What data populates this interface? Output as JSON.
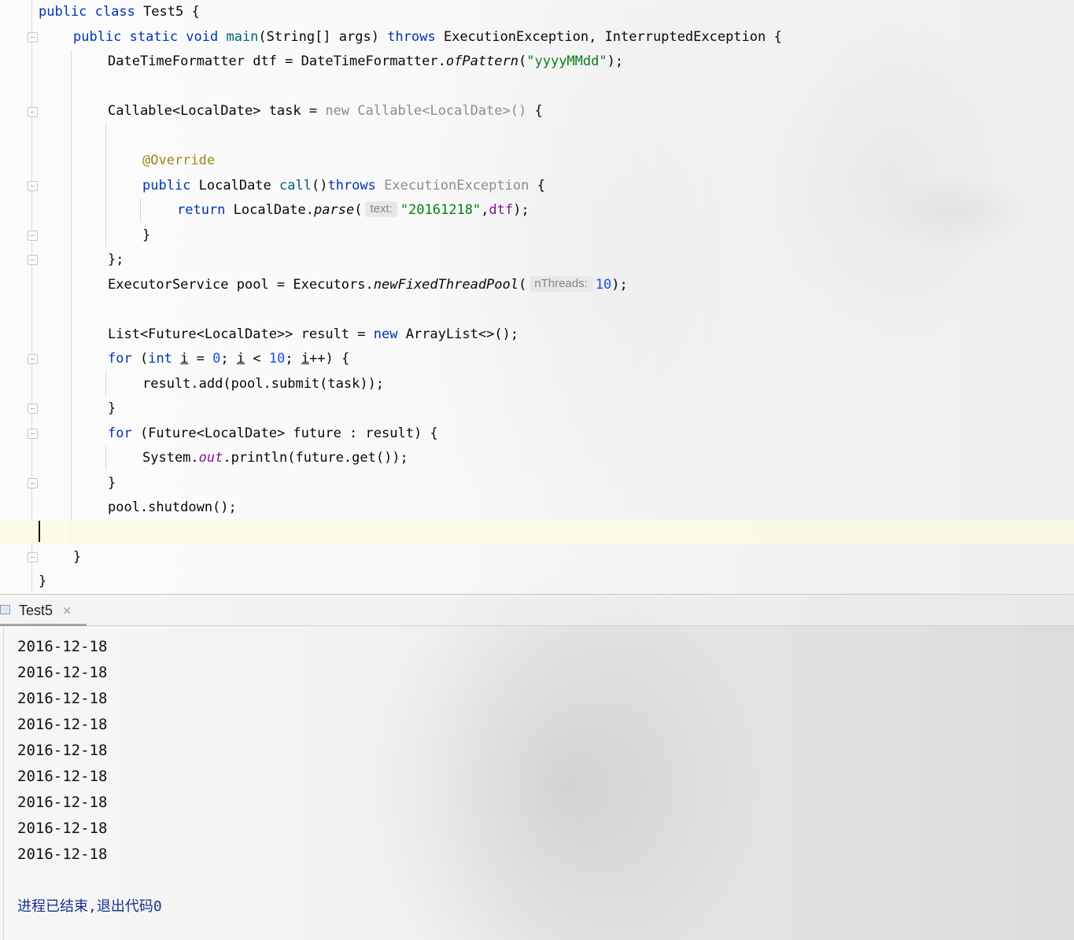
{
  "editor": {
    "lines": {
      "l1": {
        "kw1": "public class ",
        "rest": "Test5 {"
      },
      "l2": {
        "kw1": "public static void ",
        "fn": "main",
        "mid": "(String[] args) ",
        "kw2": "throws",
        "rest": " ExecutionException, InterruptedException {"
      },
      "l3": {
        "pre": "DateTimeFormatter dtf = DateTimeFormatter.",
        "it": "ofPattern",
        "open": "(",
        "str": "\"yyyyMMdd\"",
        "close": ");"
      },
      "l5": {
        "pre": "Callable<LocalDate> task = ",
        "gray": "new Callable<LocalDate>()",
        "rest": " {"
      },
      "l7": {
        "ann": "@Override"
      },
      "l8": {
        "kw": "public ",
        "mid": "LocalDate ",
        "fn": "call",
        "paren": "()",
        "kw2": "throws",
        "gray": " ExecutionException",
        "rest": " {"
      },
      "l9": {
        "kw": "return ",
        "pre": "LocalDate.",
        "it": "parse",
        "open": "(",
        "hint": "text:",
        "str": "\"20161218\"",
        "comma": ",",
        "pv": "dtf",
        "close": ");"
      },
      "l10": {
        "text": "}"
      },
      "l11": {
        "text": "};"
      },
      "l12": {
        "pre": "ExecutorService pool = Executors.",
        "it": "newFixedThreadPool",
        "open": "(",
        "hint": "nThreads:",
        "num": "10",
        "close": ");"
      },
      "l14": {
        "pre": "List<Future<LocalDate>> result = ",
        "kw": "new",
        "rest": " ArrayList<>();"
      },
      "l15": {
        "kw": "for",
        "a": " (",
        "kw2": "int",
        "b": " ",
        "v1": "i",
        "c": " = ",
        "n1": "0",
        "d": "; ",
        "v2": "i",
        "e": " < ",
        "n2": "10",
        "f": "; ",
        "v3": "i",
        "g": "++) {"
      },
      "l16": {
        "text": "result.add(pool.submit(task));"
      },
      "l17": {
        "text": "}"
      },
      "l18": {
        "kw": "for",
        "rest": " (Future<LocalDate> future : result) {"
      },
      "l19": {
        "pre": "System.",
        "sf": "out",
        "rest": ".println(future.get());"
      },
      "l20": {
        "text": "}"
      },
      "l21": {
        "text": "pool.shutdown();"
      },
      "l23": {
        "text": "}"
      },
      "l24": {
        "text": "}"
      }
    }
  },
  "run_panel": {
    "tab_label": "Test5",
    "close_icon": "×",
    "output": [
      "2016-12-18",
      "2016-12-18",
      "2016-12-18",
      "2016-12-18",
      "2016-12-18",
      "2016-12-18",
      "2016-12-18",
      "2016-12-18",
      "2016-12-18"
    ],
    "exit_message": "进程已结束,退出代码0"
  }
}
